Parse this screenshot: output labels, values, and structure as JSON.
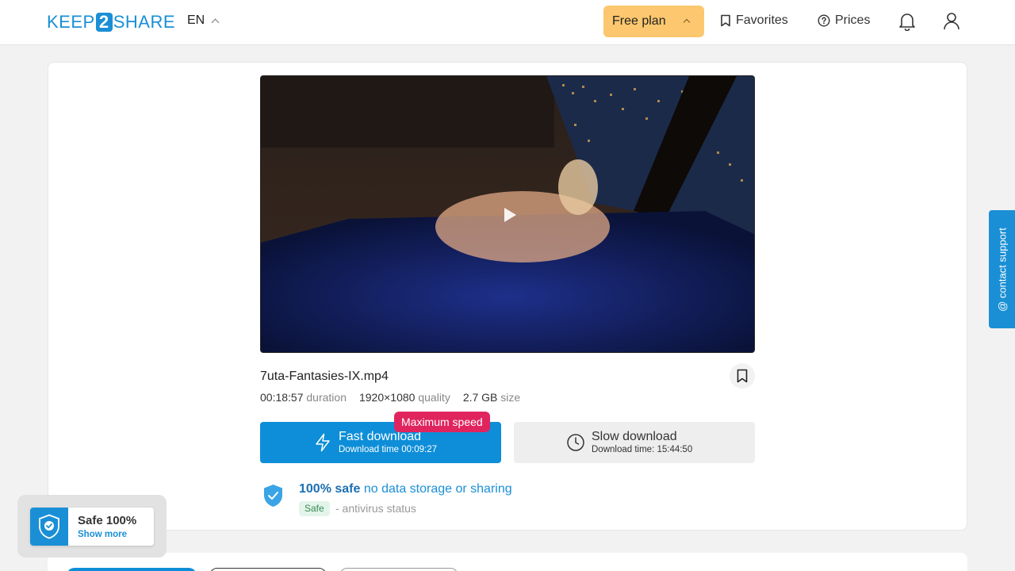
{
  "header": {
    "logo": {
      "left": "KEEP",
      "mid": "2",
      "right": "SHARE"
    },
    "language": "EN",
    "free_plan": "Free plan",
    "favorites": "Favorites",
    "prices": "Prices"
  },
  "file": {
    "name": "7uta-Fantasies-IX.mp4",
    "duration_value": "00:18:57",
    "duration_label": "duration",
    "quality_value": "1920×1080",
    "quality_label": "quality",
    "size_value": "2.7 GB",
    "size_label": "size"
  },
  "download": {
    "fast_title": "Fast download",
    "fast_time": "Download time 00:09:27",
    "badge": "Maximum speed",
    "slow_title": "Slow download",
    "slow_time": "Download time: 15:44:50"
  },
  "safety": {
    "bold": "100% safe",
    "rest": "no data storage or sharing",
    "tag": "Safe",
    "status": "- antivirus status"
  },
  "contact_support": "@ contact support",
  "safe_widget": {
    "title": "Safe 100%",
    "link": "Show more"
  },
  "colors": {
    "accent": "#1a8fd6",
    "free_plan_bg": "#fcc76e",
    "badge": "#e0245e"
  }
}
